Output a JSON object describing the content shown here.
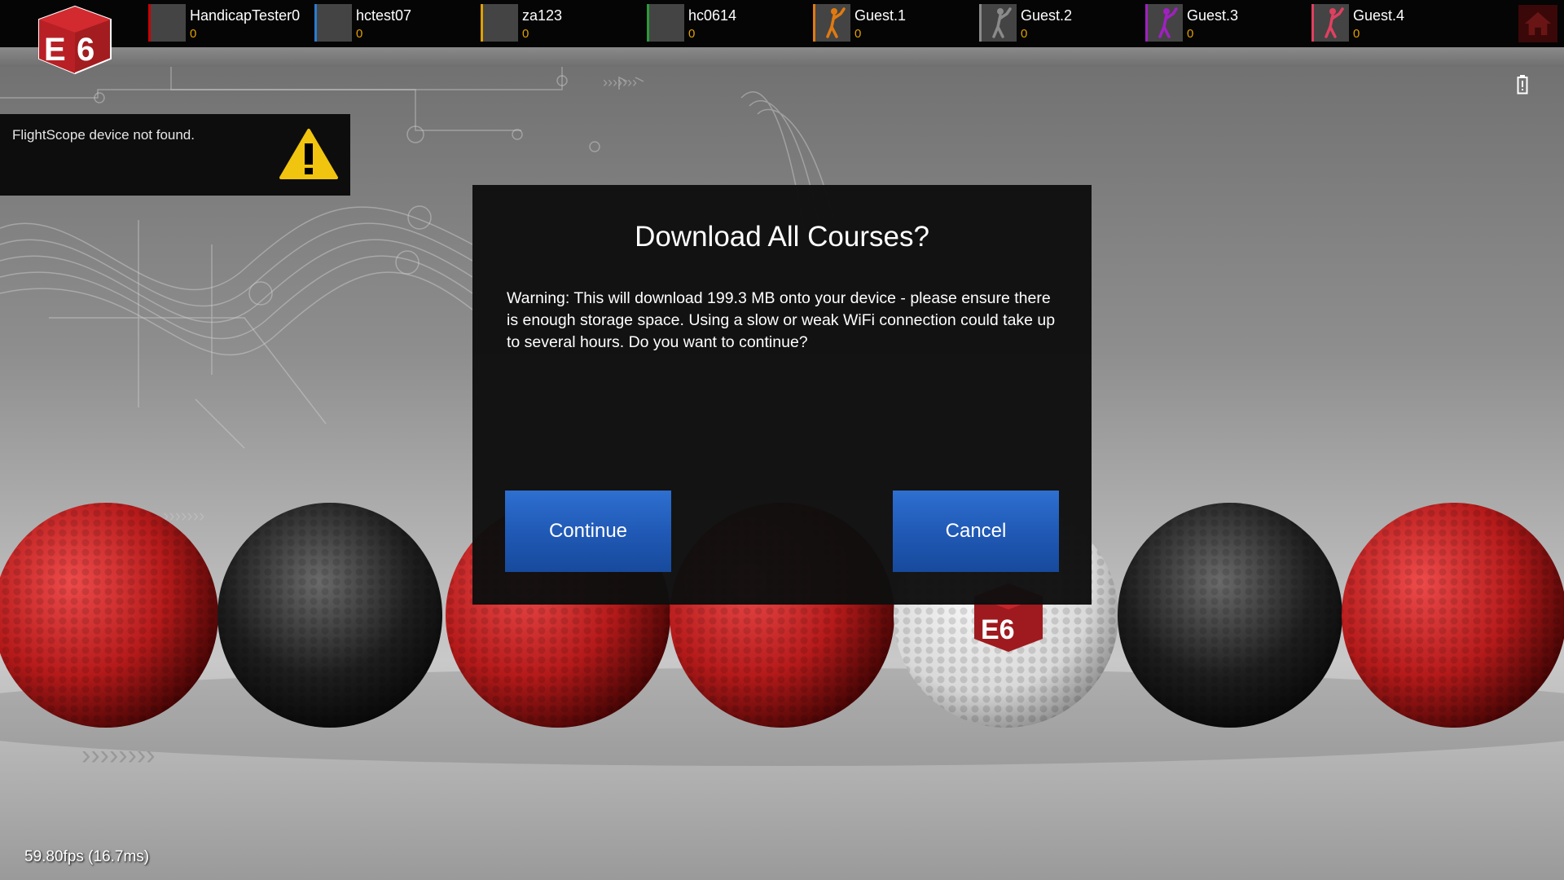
{
  "topbar": {
    "players": [
      {
        "name": "HandicapTester0",
        "score": "0",
        "avatar": "photo-avatar"
      },
      {
        "name": "hctest07",
        "score": "0",
        "avatar": "photo-avatar"
      },
      {
        "name": "za123",
        "score": "0",
        "avatar": "photo-avatar"
      },
      {
        "name": "hc0614",
        "score": "0",
        "avatar": "photo-avatar"
      },
      {
        "name": "Guest.1",
        "score": "0",
        "avatar": "golfer-icon",
        "color": "#e07a10"
      },
      {
        "name": "Guest.2",
        "score": "0",
        "avatar": "golfer-icon",
        "color": "#8a8a8a"
      },
      {
        "name": "Guest.3",
        "score": "0",
        "avatar": "golfer-icon",
        "color": "#a020c0"
      },
      {
        "name": "Guest.4",
        "score": "0",
        "avatar": "golfer-icon",
        "color": "#e04060"
      }
    ],
    "logo_icon": "e6-logo",
    "home_icon": "home-icon"
  },
  "notice": {
    "text": "FlightScope device not found.",
    "icon": "warning-icon"
  },
  "dialog": {
    "title": "Download All Courses?",
    "body": "Warning: This will download 199.3 MB onto your device - please ensure there is enough storage space. Using a slow or weak WiFi connection could take up to several hours. Do you want to continue?",
    "continue_label": "Continue",
    "cancel_label": "Cancel"
  },
  "status": {
    "fps": "59.80fps (16.7ms)",
    "battery_icon": "battery-icon"
  },
  "colors": {
    "accent_button": "#1f58b4",
    "score": "#e0a000",
    "brand_red": "#c81e24"
  }
}
